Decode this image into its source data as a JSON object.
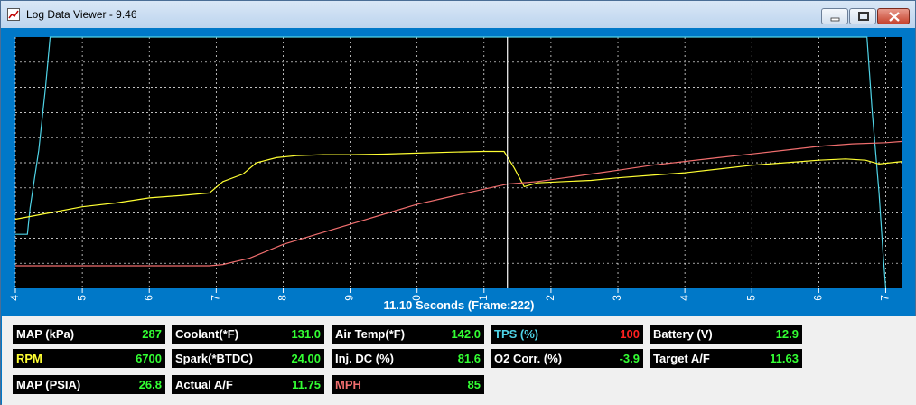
{
  "window": {
    "title": "Log Data Viewer - 9.46",
    "app_icon": "chart-app-icon"
  },
  "controls": {
    "minimize": "minimize-icon",
    "maximize": "maximize-icon",
    "close": "close-icon"
  },
  "chart_data": {
    "type": "line",
    "xlabel": "11.10 Seconds (Frame:222)",
    "xlim": [
      4,
      17.25
    ],
    "x_ticks": [
      4,
      5,
      6,
      7,
      8,
      9,
      10,
      11,
      12,
      13,
      14,
      15,
      16,
      17
    ],
    "tick_labels": [
      "4",
      "5",
      "6",
      "7",
      "8",
      "9",
      "0",
      "1",
      "2",
      "3",
      "4",
      "5",
      "6",
      "7"
    ],
    "cursor_x": 11.35,
    "grid": true,
    "colors": {
      "background": "#000000",
      "grid": "#ffffff",
      "cursor": "#ffffff",
      "axis_band": "#0078c8"
    },
    "series": [
      {
        "color": "#4fd3e6",
        "points": [
          [
            4,
            0.785
          ],
          [
            4.18,
            0.785
          ],
          [
            4.22,
            0.68
          ],
          [
            4.35,
            0.45
          ],
          [
            4.45,
            0.2
          ],
          [
            4.52,
            0.0
          ],
          [
            16.72,
            0.0
          ],
          [
            16.8,
            0.3
          ],
          [
            16.9,
            0.62
          ],
          [
            16.96,
            0.86
          ],
          [
            17.0,
            1.0
          ]
        ]
      },
      {
        "color": "#ffff33",
        "points": [
          [
            4,
            0.725
          ],
          [
            4.5,
            0.7
          ],
          [
            5,
            0.675
          ],
          [
            5.5,
            0.66
          ],
          [
            6,
            0.64
          ],
          [
            6.5,
            0.63
          ],
          [
            6.9,
            0.62
          ],
          [
            7.1,
            0.575
          ],
          [
            7.4,
            0.545
          ],
          [
            7.6,
            0.5
          ],
          [
            7.9,
            0.48
          ],
          [
            8.2,
            0.472
          ],
          [
            8.6,
            0.468
          ],
          [
            9,
            0.468
          ],
          [
            9.5,
            0.466
          ],
          [
            10,
            0.462
          ],
          [
            10.5,
            0.458
          ],
          [
            11,
            0.455
          ],
          [
            11.3,
            0.455
          ],
          [
            11.45,
            0.52
          ],
          [
            11.6,
            0.595
          ],
          [
            11.8,
            0.58
          ],
          [
            12.2,
            0.575
          ],
          [
            12.6,
            0.57
          ],
          [
            13,
            0.56
          ],
          [
            13.5,
            0.55
          ],
          [
            14,
            0.54
          ],
          [
            14.5,
            0.525
          ],
          [
            15,
            0.51
          ],
          [
            15.5,
            0.5
          ],
          [
            16,
            0.49
          ],
          [
            16.4,
            0.485
          ],
          [
            16.7,
            0.49
          ],
          [
            16.9,
            0.505
          ],
          [
            17.25,
            0.495
          ]
        ]
      },
      {
        "color": "#f06e6e",
        "points": [
          [
            4,
            0.91
          ],
          [
            6.9,
            0.91
          ],
          [
            7.1,
            0.905
          ],
          [
            7.5,
            0.88
          ],
          [
            8,
            0.825
          ],
          [
            8.5,
            0.785
          ],
          [
            9,
            0.745
          ],
          [
            9.5,
            0.705
          ],
          [
            10,
            0.665
          ],
          [
            10.5,
            0.635
          ],
          [
            11,
            0.605
          ],
          [
            11.35,
            0.585
          ],
          [
            11.8,
            0.575
          ],
          [
            12.2,
            0.56
          ],
          [
            12.6,
            0.545
          ],
          [
            13,
            0.53
          ],
          [
            13.5,
            0.51
          ],
          [
            14,
            0.495
          ],
          [
            14.5,
            0.48
          ],
          [
            15,
            0.465
          ],
          [
            15.5,
            0.45
          ],
          [
            16,
            0.435
          ],
          [
            16.5,
            0.425
          ],
          [
            17,
            0.42
          ],
          [
            17.25,
            0.415
          ]
        ]
      }
    ]
  },
  "gauges": [
    {
      "label": "MAP (kPa)",
      "value": "287",
      "label_color": "#ffffff",
      "value_color": "#33ff33"
    },
    {
      "label": "Coolant(*F)",
      "value": "131.0",
      "label_color": "#ffffff",
      "value_color": "#33ff33"
    },
    {
      "label": "Air Temp(*F)",
      "value": "142.0",
      "label_color": "#ffffff",
      "value_color": "#33ff33"
    },
    {
      "label": "TPS (%)",
      "value": "100",
      "label_color": "#4fd3e6",
      "value_color": "#ff2020"
    },
    {
      "label": "Battery (V)",
      "value": "12.9",
      "label_color": "#ffffff",
      "value_color": "#33ff33"
    },
    {
      "label": "RPM",
      "value": "6700",
      "label_color": "#ffff33",
      "value_color": "#33ff33"
    },
    {
      "label": "Spark(*BTDC)",
      "value": "24.00",
      "label_color": "#ffffff",
      "value_color": "#33ff33"
    },
    {
      "label": "Inj. DC (%)",
      "value": "81.6",
      "label_color": "#ffffff",
      "value_color": "#33ff33"
    },
    {
      "label": "O2 Corr. (%)",
      "value": "-3.9",
      "label_color": "#ffffff",
      "value_color": "#33ff33"
    },
    {
      "label": "Target A/F",
      "value": "11.63",
      "label_color": "#ffffff",
      "value_color": "#33ff33"
    },
    {
      "label": "MAP (PSIA)",
      "value": "26.8",
      "label_color": "#ffffff",
      "value_color": "#33ff33"
    },
    {
      "label": "Actual A/F",
      "value": "11.75",
      "label_color": "#ffffff",
      "value_color": "#33ff33"
    },
    {
      "label": "MPH",
      "value": "85",
      "label_color": "#f06e6e",
      "value_color": "#33ff33"
    }
  ]
}
